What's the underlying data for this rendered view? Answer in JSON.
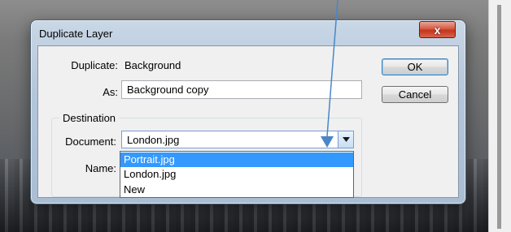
{
  "dialog": {
    "title": "Duplicate Layer",
    "close_glyph": "x",
    "duplicate_label": "Duplicate:",
    "duplicate_value": "Background",
    "as_label": "As:",
    "as_value": "Background copy",
    "destination_title": "Destination",
    "document_label": "Document:",
    "document_value": "London.jpg",
    "name_label": "Name:",
    "ok_label": "OK",
    "cancel_label": "Cancel"
  },
  "dropdown": {
    "options": [
      "Portrait.jpg",
      "London.jpg",
      "New"
    ],
    "selected_index": 0
  },
  "colors": {
    "selection": "#3399ff",
    "annotation_arrow": "#4a86c8",
    "close_button": "#c2361d"
  },
  "icons": {
    "dropdown": "chevron-down-icon",
    "annotation": "arrow-annotation-icon"
  }
}
